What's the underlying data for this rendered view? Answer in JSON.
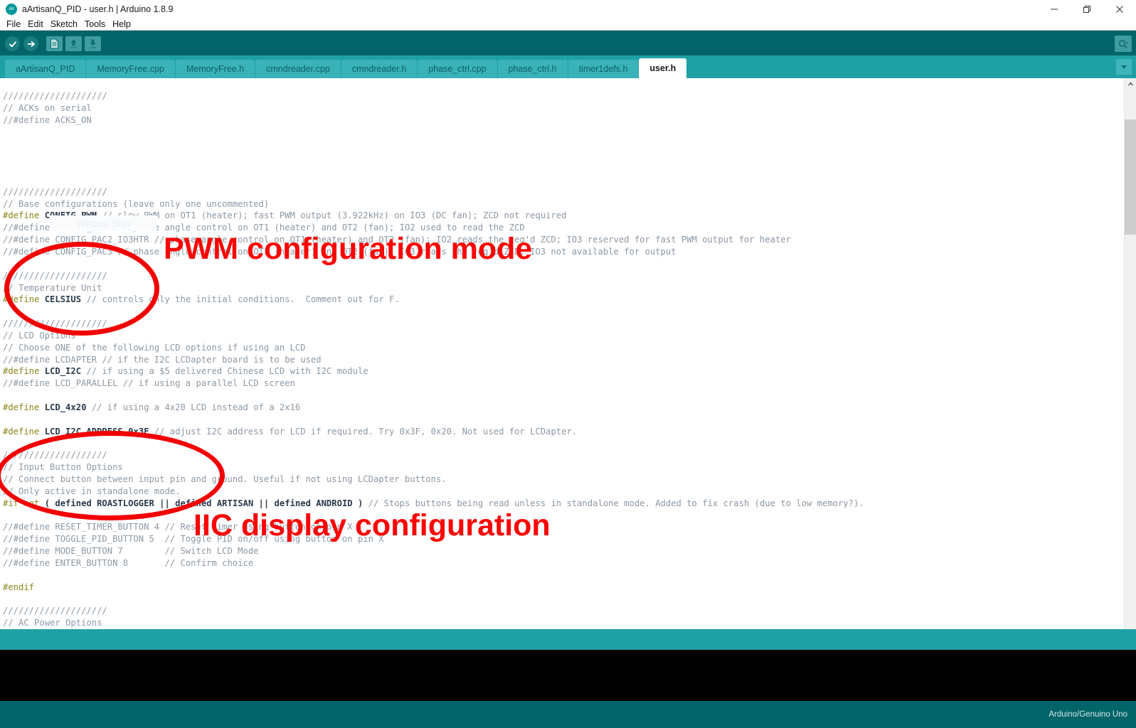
{
  "window": {
    "title": "aArtisanQ_PID - user.h | Arduino 1.8.9",
    "app_icon": "arduino-infinity-icon",
    "minimize": "–",
    "maximize": "❐",
    "close": "✕"
  },
  "menu": {
    "items": [
      {
        "label": "File"
      },
      {
        "label": "Edit"
      },
      {
        "label": "Sketch"
      },
      {
        "label": "Tools"
      },
      {
        "label": "Help"
      }
    ]
  },
  "toolbar": {
    "verify": "verify-icon",
    "upload": "upload-icon",
    "new": "new-sketch-icon",
    "open": "open-sketch-icon",
    "save": "save-sketch-icon",
    "serial_monitor": "serial-monitor-icon"
  },
  "tabs": {
    "items": [
      {
        "label": "aArtisanQ_PID",
        "active": false
      },
      {
        "label": "MemoryFree.cpp",
        "active": false
      },
      {
        "label": "MemoryFree.h",
        "active": false
      },
      {
        "label": "cmndreader.cpp",
        "active": false
      },
      {
        "label": "cmndreader.h",
        "active": false
      },
      {
        "label": "phase_ctrl.cpp",
        "active": false
      },
      {
        "label": "phase_ctrl.h",
        "active": false
      },
      {
        "label": "timer1defs.h",
        "active": false
      },
      {
        "label": "user.h",
        "active": true
      }
    ],
    "dropdown": "chevron-down-icon"
  },
  "overlay": {
    "window_snip_label": "Window Snip"
  },
  "annotations": [
    {
      "id": "pwm",
      "text": "PWM configuration mode",
      "color": "#fc0303"
    },
    {
      "id": "iic",
      "text": "IIC display configuration",
      "color": "#fc0303"
    }
  ],
  "editor": {
    "filename": "user.h",
    "lines": [
      [
        {
          "t": "cmt",
          "s": "////////////////////"
        }
      ],
      [
        {
          "t": "cmt",
          "s": "// ACKs on serial"
        }
      ],
      [
        {
          "t": "cmt",
          "s": "//#define ACKS_ON"
        }
      ],
      [
        {
          "t": "plain",
          "s": ""
        }
      ],
      [
        {
          "t": "plain",
          "s": ""
        }
      ],
      [
        {
          "t": "plain",
          "s": ""
        }
      ],
      [
        {
          "t": "plain",
          "s": ""
        }
      ],
      [
        {
          "t": "plain",
          "s": ""
        }
      ],
      [
        {
          "t": "cmt",
          "s": "////////////////////"
        }
      ],
      [
        {
          "t": "cmt",
          "s": "// Base configurations (leave only one uncommented)"
        }
      ],
      [
        {
          "t": "pre",
          "s": "#define "
        },
        {
          "t": "kw",
          "s": "CONFIG_PWM"
        },
        {
          "t": "cmt",
          "s": " // slow PWM on OT1 (heater); fast PWM output (3.922kHz) on IO3 (DC fan); ZCD not required"
        }
      ],
      [
        {
          "t": "cmt",
          "s": "//#define CONFIG_PAC2 // phase angle control on OT1 (heater) and OT2 (fan); IO2 used to read the ZCD"
        }
      ],
      [
        {
          "t": "cmt",
          "s": "//#define CONFIG_PAC2_IO3HTR // phase angle control on OT1 (heater) and OT2 (fan); IO2 reads the req'd ZCD; IO3 reserved for fast PWM output for heater"
        }
      ],
      [
        {
          "t": "cmt",
          "s": "//#define CONFIG_PAC3 // phase angle control on OT1 (heater) and OT2 (fan); IO3 reads the req'd ZCD; IO3 not available for output"
        }
      ],
      [
        {
          "t": "plain",
          "s": ""
        }
      ],
      [
        {
          "t": "cmt",
          "s": "////////////////////"
        }
      ],
      [
        {
          "t": "cmt",
          "s": "// Temperature Unit"
        }
      ],
      [
        {
          "t": "pre",
          "s": "#define "
        },
        {
          "t": "kw",
          "s": "CELSIUS"
        },
        {
          "t": "cmt",
          "s": " // controls only the initial conditions.  Comment out for F."
        }
      ],
      [
        {
          "t": "plain",
          "s": ""
        }
      ],
      [
        {
          "t": "cmt",
          "s": "////////////////////"
        }
      ],
      [
        {
          "t": "cmt",
          "s": "// LCD Options"
        }
      ],
      [
        {
          "t": "cmt",
          "s": "// Choose ONE of the following LCD options if using an LCD"
        }
      ],
      [
        {
          "t": "cmt",
          "s": "//#define LCDAPTER // if the I2C LCDapter board is to be used"
        }
      ],
      [
        {
          "t": "pre",
          "s": "#define "
        },
        {
          "t": "kw",
          "s": "LCD_I2C"
        },
        {
          "t": "cmt",
          "s": " // if using a $5 delivered Chinese LCD with I2C module"
        }
      ],
      [
        {
          "t": "cmt",
          "s": "//#define LCD_PARALLEL // if using a parallel LCD screen"
        }
      ],
      [
        {
          "t": "plain",
          "s": ""
        }
      ],
      [
        {
          "t": "pre",
          "s": "#define "
        },
        {
          "t": "kw",
          "s": "LCD_4x20"
        },
        {
          "t": "cmt",
          "s": " // if using a 4x20 LCD instead of a 2x16"
        }
      ],
      [
        {
          "t": "plain",
          "s": ""
        }
      ],
      [
        {
          "t": "pre",
          "s": "#define "
        },
        {
          "t": "kw",
          "s": "LCD_I2C_ADDRESS 0x3F"
        },
        {
          "t": "cmt",
          "s": " // adjust I2C address for LCD if required. Try 0x3F, 0x20. Not used for LCDapter."
        }
      ],
      [
        {
          "t": "plain",
          "s": ""
        }
      ],
      [
        {
          "t": "cmt",
          "s": "////////////////////"
        }
      ],
      [
        {
          "t": "cmt",
          "s": "// Input Button Options"
        }
      ],
      [
        {
          "t": "cmt",
          "s": "// Connect button between input pin and ground. Useful if not using LCDapter buttons."
        }
      ],
      [
        {
          "t": "cmt",
          "s": "// Only active in standalone mode."
        }
      ],
      [
        {
          "t": "pre",
          "s": "#if not "
        },
        {
          "t": "kw",
          "s": "( defined ROASTLOGGER || defined ARTISAN || defined ANDROID )"
        },
        {
          "t": "cmt",
          "s": " // Stops buttons being read unless in standalone mode. Added to fix crash (due to low memory?)."
        }
      ],
      [
        {
          "t": "plain",
          "s": ""
        }
      ],
      [
        {
          "t": "cmt",
          "s": "//#define RESET_TIMER_BUTTON 4 // Reset timer using button on pin X"
        }
      ],
      [
        {
          "t": "cmt",
          "s": "//#define TOGGLE_PID_BUTTON 5  // Toggle PID on/off using button on pin X"
        }
      ],
      [
        {
          "t": "cmt",
          "s": "//#define MODE_BUTTON 7        // Switch LCD Mode"
        }
      ],
      [
        {
          "t": "cmt",
          "s": "//#define ENTER_BUTTON 8       // Confirm choice"
        }
      ],
      [
        {
          "t": "plain",
          "s": ""
        }
      ],
      [
        {
          "t": "pre",
          "s": "#endif"
        }
      ],
      [
        {
          "t": "plain",
          "s": ""
        }
      ],
      [
        {
          "t": "cmt",
          "s": "////////////////////"
        }
      ],
      [
        {
          "t": "cmt",
          "s": "// AC Power Options"
        }
      ]
    ]
  },
  "scrollbar": {
    "up_arrow": "chevron-up-icon",
    "down_arrow": "chevron-down-icon"
  },
  "statusbar": {
    "line_info": "",
    "board": "Arduino/Genuino Uno"
  }
}
